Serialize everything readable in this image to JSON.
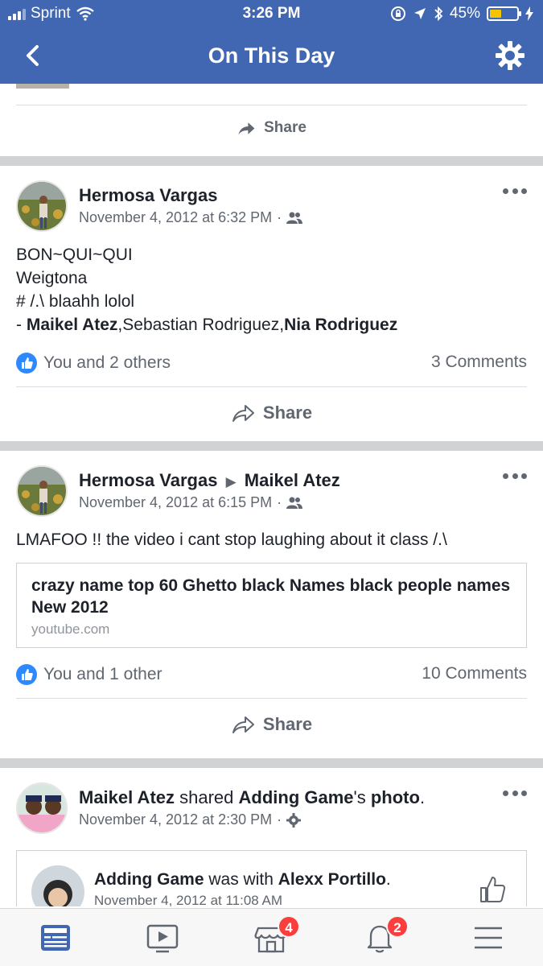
{
  "status_bar": {
    "carrier": "Sprint",
    "time": "3:26 PM",
    "battery": "45%",
    "battery_level": 0.45
  },
  "header": {
    "title": "On This Day"
  },
  "partial_top_card": {
    "share_label": "Share"
  },
  "posts": [
    {
      "author": "Hermosa Vargas",
      "timestamp": "November 4, 2012 at 6:32 PM",
      "audience_icon": "friends-icon",
      "lines": [
        "BON~QUI~QUI",
        "Weigtona",
        "# /.\\ blaahh lolol"
      ],
      "tag_prefix": "- ",
      "tag_1": "Maikel Atez",
      "tag_2": ",Sebastian Rodriguez,",
      "tag_3": "Nia Rodriguez",
      "likes": "You and 2 others",
      "comments": "3 Comments",
      "share_label": "Share"
    },
    {
      "author": "Hermosa Vargas",
      "target": "Maikel Atez",
      "timestamp": "November 4, 2012 at 6:15 PM",
      "audience_icon": "friends-icon",
      "text": "LMAFOO !! the video i cant stop laughing about it class /.\\",
      "link_title": "crazy name top 60 Ghetto black Names black people names New 2012",
      "link_domain": "youtube.com",
      "likes": "You and 1 other",
      "comments": "10 Comments",
      "share_label": "Share"
    },
    {
      "author": "Maikel Atez",
      "shared_text": " shared ",
      "page": "Adding Game",
      "possessive": "'s ",
      "object": "photo",
      "period": ".",
      "timestamp": "November 4, 2012 at 2:30 PM",
      "audience_icon": "gear-icon",
      "shared_author": "Adding Game",
      "was_with": " was with ",
      "with_person": "Alexx Portillo",
      "shared_period": ".",
      "shared_timestamp": "November 4, 2012 at 11:08 AM"
    }
  ],
  "tabbar": {
    "tabs": [
      "news-feed-icon",
      "video-icon",
      "marketplace-icon",
      "notifications-icon",
      "menu-icon"
    ],
    "marketplace_badge": "4",
    "notifications_badge": "2"
  },
  "colors": {
    "brand": "#4267b2",
    "like": "#2e89ff",
    "badge": "#fa3e3e"
  }
}
